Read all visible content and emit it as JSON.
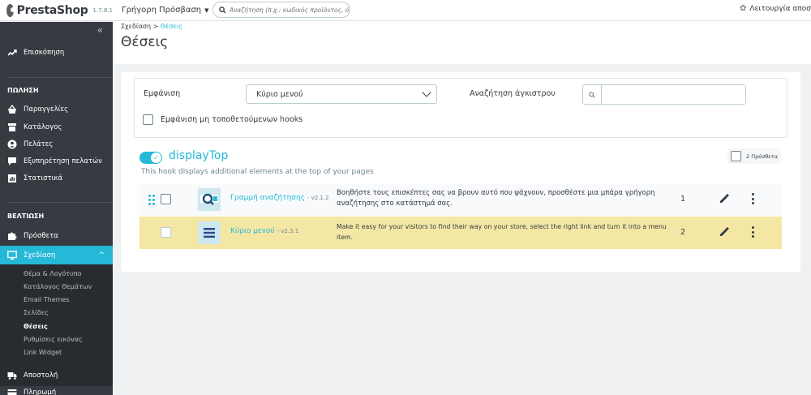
{
  "header": {
    "logo_text": "PrestaShop",
    "version": "1.7.8.1",
    "quick_access": "Γρήγορη Πρόσβαση",
    "search_placeholder": "Αναζήτηση (π.χ.: κωδικός προϊόντος, ό",
    "maintenance": "Λειτουργία αποσ"
  },
  "sidebar": {
    "dashboard": "Επισκόπηση",
    "sell_title": "ΠΩΛΗΣΗ",
    "sell_items": [
      "Παραγγελίες",
      "Κατάλογος",
      "Πελάτες",
      "Εξυπηρέτηση πελατών",
      "Στατιστικά"
    ],
    "improve_title": "ΒΕΛΤΙΩΣΗ",
    "modules": "Πρόσθετα",
    "design": "Σχεδίαση",
    "design_sub": [
      "Θέμα & Λογότυπο",
      "Κατάλογος Θεμάτων",
      "Email Themes",
      "Σελίδες",
      "Θέσεις",
      "Ρυθμίσεις εικόνας",
      "Link Widget"
    ],
    "shipping": "Αποστολή",
    "payment": "Πληρωμή"
  },
  "page": {
    "breadcrumb_parent": "Σχεδίαση",
    "breadcrumb_sep": ">",
    "breadcrumb_current": "Θέσεις",
    "title": "Θέσεις"
  },
  "filters": {
    "show_label": "Εμφάνιση",
    "show_value": "Κύριο μενού",
    "search_hook_label": "Αναζήτηση άγκιστρου",
    "search_hook_value": "",
    "unhooked_label": "Εμφάνιση μη τοποθετούμενων hooks"
  },
  "hook": {
    "name": "displayTop",
    "description": "This hook displays additional elements at the top of your pages",
    "module_count": "2 Πρόσθετα",
    "modules": [
      {
        "name": "Γραμμή αναζήτησης",
        "version": "- v2.1.2",
        "description": "Βοηθήστε τους επισκέπτες σας να βρουν αυτό που ψάχνουν, προσθέστε μια μπάρα γρήγορη αναζήτησης στο κατάστημά σας.",
        "position": "1",
        "icon": "search-module-icon"
      },
      {
        "name": "Κύριο μενού",
        "version": "- v2.3.1",
        "description": "Make it easy for your visitors to find their way on your store, select the right link and turn it into a menu item.",
        "position": "2",
        "icon": "menu-module-icon"
      }
    ]
  },
  "colors": {
    "accent": "#25b9d7",
    "sidebar_bg": "#363a41",
    "highlight_row": "#f4e7a4"
  }
}
